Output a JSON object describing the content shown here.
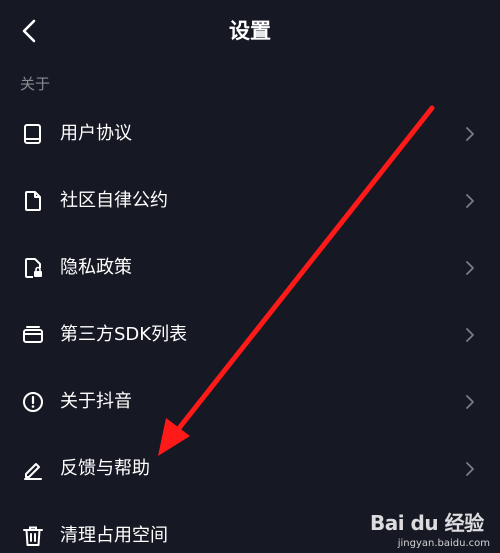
{
  "header": {
    "title": "设置",
    "back_icon": "chevron-left-icon"
  },
  "section": {
    "label": "关于"
  },
  "items": [
    {
      "label": "用户协议",
      "icon": "book-icon"
    },
    {
      "label": "社区自律公约",
      "icon": "document-icon"
    },
    {
      "label": "隐私政策",
      "icon": "privacy-lock-icon"
    },
    {
      "label": "第三方SDK列表",
      "icon": "folder-list-icon"
    },
    {
      "label": "关于抖音",
      "icon": "info-circle-icon"
    },
    {
      "label": "反馈与帮助",
      "icon": "pencil-icon"
    },
    {
      "label": "清理占用空间",
      "icon": "trash-icon"
    }
  ],
  "watermark": {
    "logo": "Bai du 经验",
    "site": "jingyan.baidu.com"
  },
  "colors": {
    "background": "#161823",
    "text": "#ffffff",
    "muted": "#8a8b91",
    "annotation_arrow": "#ff1a1a"
  }
}
